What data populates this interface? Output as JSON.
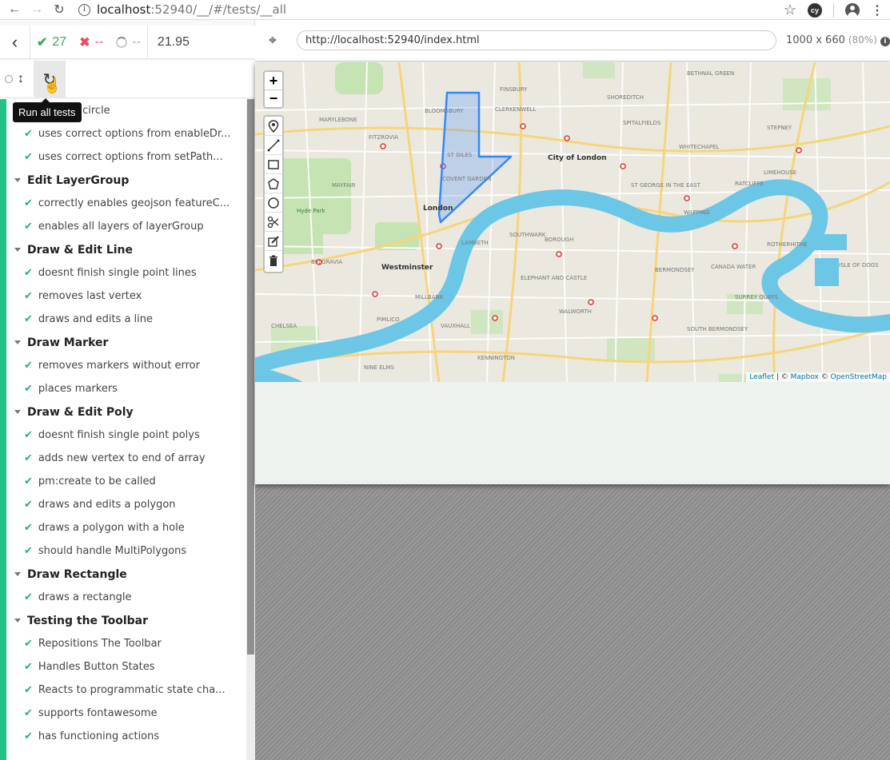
{
  "browser": {
    "url_host": "localhost",
    "url_rest": ":52940/__/#/tests/__all",
    "profile_badge": "cy",
    "icons": [
      "back-arrow-icon",
      "forward-arrow-icon",
      "reload-icon",
      "info-icon",
      "star-icon",
      "account-icon",
      "kebab-menu-icon"
    ]
  },
  "reporter": {
    "passed": "27",
    "failed": "--",
    "pending": "--",
    "duration": "21.95",
    "tooltip": "Run all tests",
    "colors": {
      "pass": "#3ea75a",
      "fail": "#e94f5f",
      "status_bar": "#22c286"
    },
    "suites": [
      {
        "title": "",
        "tests": [
          "draws a circle",
          "uses correct options from enableDr...",
          "uses correct options from setPath..."
        ]
      },
      {
        "title": "Edit LayerGroup",
        "tests": [
          "correctly enables geojson featureC...",
          "enables all layers of layerGroup"
        ]
      },
      {
        "title": "Draw & Edit Line",
        "tests": [
          "doesnt finish single point lines",
          "removes last vertex",
          "draws and edits a line"
        ]
      },
      {
        "title": "Draw Marker",
        "tests": [
          "removes markers without error",
          "places markers"
        ]
      },
      {
        "title": "Draw & Edit Poly",
        "tests": [
          "doesnt finish single point polys",
          "adds new vertex to end of array",
          "pm:create to be called",
          "draws and edits a polygon",
          "draws a polygon with a hole",
          "should handle MultiPolygons"
        ]
      },
      {
        "title": "Draw Rectangle",
        "tests": [
          "draws a rectangle"
        ]
      },
      {
        "title": "Testing the Toolbar",
        "tests": [
          "Repositions The Toolbar",
          "Handles Button States",
          "Reacts to programmatic state cha...",
          "supports fontawesome",
          "has functioning actions"
        ]
      }
    ]
  },
  "runner": {
    "app_url": "http://localhost:52940/index.html",
    "viewport": "1000 x 660",
    "scale": "(80%)"
  },
  "map": {
    "zoom_in": "+",
    "zoom_out": "−",
    "draw_tools": [
      "marker-icon",
      "line-icon",
      "rectangle-icon",
      "polygon-icon",
      "circle-icon",
      "cut-icon",
      "edit-icon",
      "delete-icon"
    ],
    "attribution_leaflet": "Leaflet",
    "attribution_sep": " | © ",
    "attribution_mapbox": "Mapbox",
    "attribution_sep2": " © ",
    "attribution_osm": "OpenStreetMap",
    "labels": {
      "city": "City of London",
      "london": "London",
      "westminster": "Westminster",
      "clerkenwell": "CLERKENWELL",
      "finsbury": "FINSBURY",
      "bloomsbury": "BLOOMSBURY",
      "marylebone": "MARYLEBONE",
      "fitzrovia": "FITZROVIA",
      "st_giles": "ST GILES",
      "covent_garden": "COVENT GARDEN",
      "mayfair": "MAYFAIR",
      "hyde_park": "Hyde Park",
      "belgravia": "BELGRAVIA",
      "southwark": "SOUTHWARK",
      "lambeth": "LAMBETH",
      "millbank": "MILLBANK",
      "pimlico": "PIMLICO",
      "chelsea": "CHELSEA",
      "vauxhall": "VAUXHALL",
      "kennington": "KENNINGTON",
      "walworth": "WALWORTH",
      "bermondsey": "BERMONDSEY",
      "rotherhithe": "ROTHERHITHE",
      "whitechapel": "WHITECHAPEL",
      "spitalfields": "SPITALFIELDS",
      "shoreditch": "SHOREDITCH",
      "wapping": "WAPPING",
      "limehouse": "LIMEHOUSE",
      "stepney": "STEPNEY",
      "canada_water": "CANADA WATER",
      "elephant": "ELEPHANT AND CASTLE",
      "nine_elms": "NINE ELMS",
      "borough": "BOROUGH",
      "bethnal_green": "BETHNAL GREEN",
      "south_bermondsey": "SOUTH BERMONDSEY",
      "surrey_quays": "SURREY QUAYS",
      "isle_of_dogs": "ISLE OF DOGS",
      "st_georges": "ST GEORGE IN THE EAST",
      "ratcliffe": "RATCLIFFE"
    }
  }
}
